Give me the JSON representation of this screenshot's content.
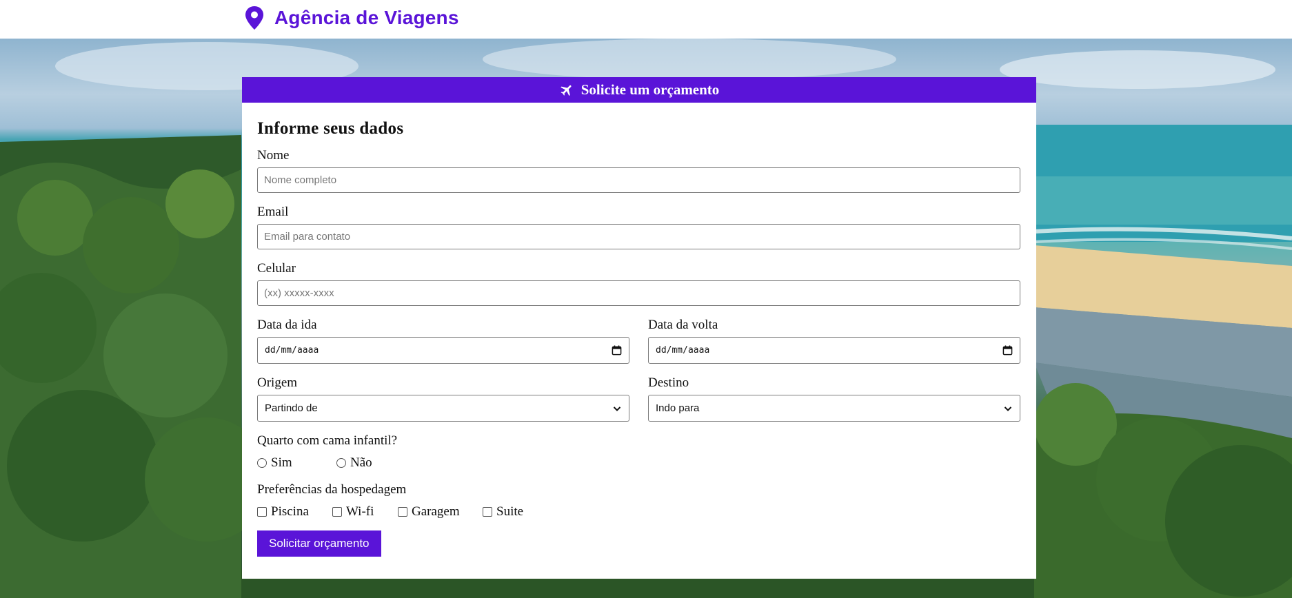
{
  "header": {
    "brand_title": "Agência de Viagens",
    "brand_icon": "map-pin-icon",
    "accent_color": "#5a14d8"
  },
  "card": {
    "header_title": "Solicite um orçamento",
    "header_icon": "airplane-icon",
    "section_title": "Informe seus dados",
    "fields": {
      "nome": {
        "label": "Nome",
        "placeholder": "Nome completo"
      },
      "email": {
        "label": "Email",
        "placeholder": "Email para contato"
      },
      "celular": {
        "label": "Celular",
        "placeholder": "(xx) xxxxx-xxxx"
      },
      "data_ida": {
        "label": "Data da ida",
        "value": "dd/mm/aaaa"
      },
      "data_volta": {
        "label": "Data da volta",
        "value": "dd/mm/aaaa"
      },
      "origem": {
        "label": "Origem",
        "selected": "Partindo de"
      },
      "destino": {
        "label": "Destino",
        "selected": "Indo para"
      }
    },
    "quarto": {
      "label": "Quarto com cama infantil?",
      "options": [
        "Sim",
        "Não"
      ]
    },
    "preferencias": {
      "label": "Preferências da hospedagem",
      "options": [
        "Piscina",
        "Wi-fi",
        "Garagem",
        "Suite"
      ]
    },
    "submit_label": "Solicitar orçamento"
  }
}
